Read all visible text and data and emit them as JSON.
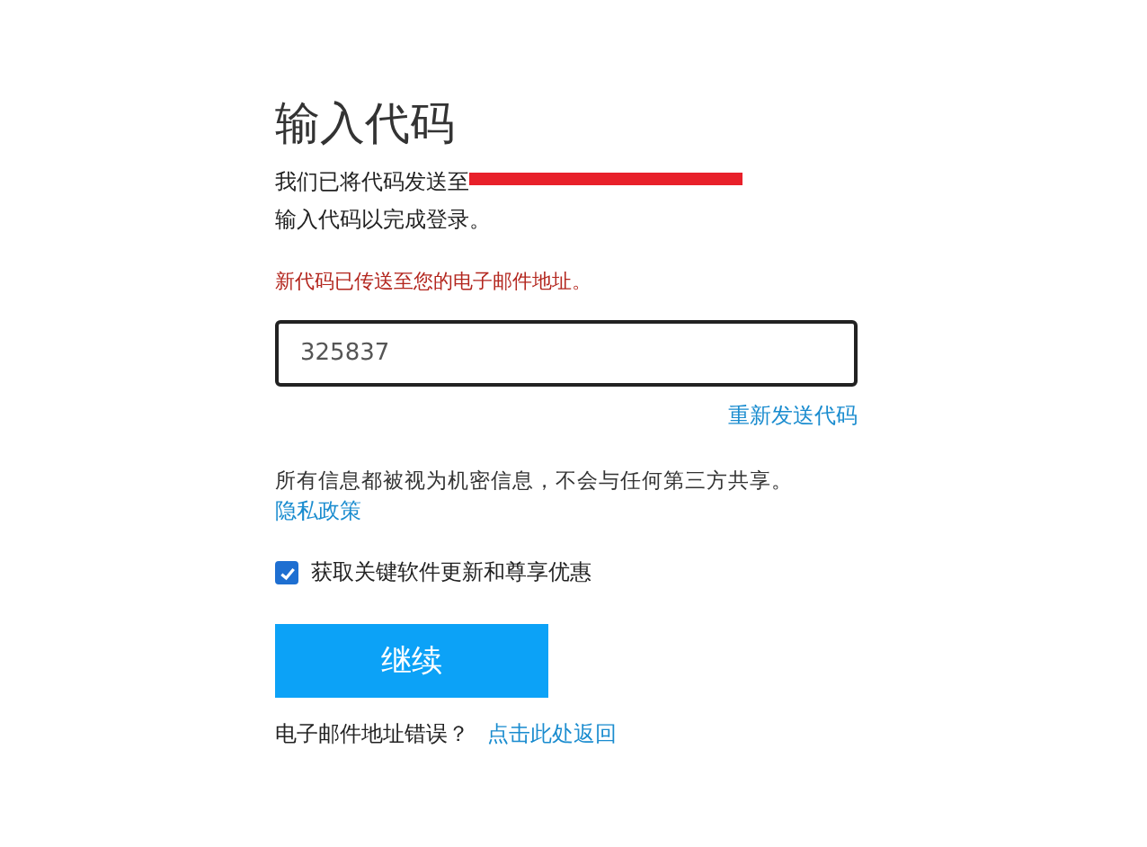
{
  "title": "输入代码",
  "sent_line": "我们已将代码发送至",
  "email_redacted": true,
  "instruction": "输入代码以完成登录。",
  "notice": "新代码已传送至您的电子邮件地址。",
  "code_field": {
    "value": "325837"
  },
  "resend_link": "重新发送代码",
  "privacy": {
    "text": "所有信息都被视为机密信息，不会与任何第三方共享。",
    "link": "隐私政策"
  },
  "updates_checkbox": {
    "label": "获取关键软件更新和尊享优惠",
    "checked": true
  },
  "continue_button": "继续",
  "wrong_email": {
    "text": "电子邮件地址错误？",
    "link": "点击此处返回"
  }
}
